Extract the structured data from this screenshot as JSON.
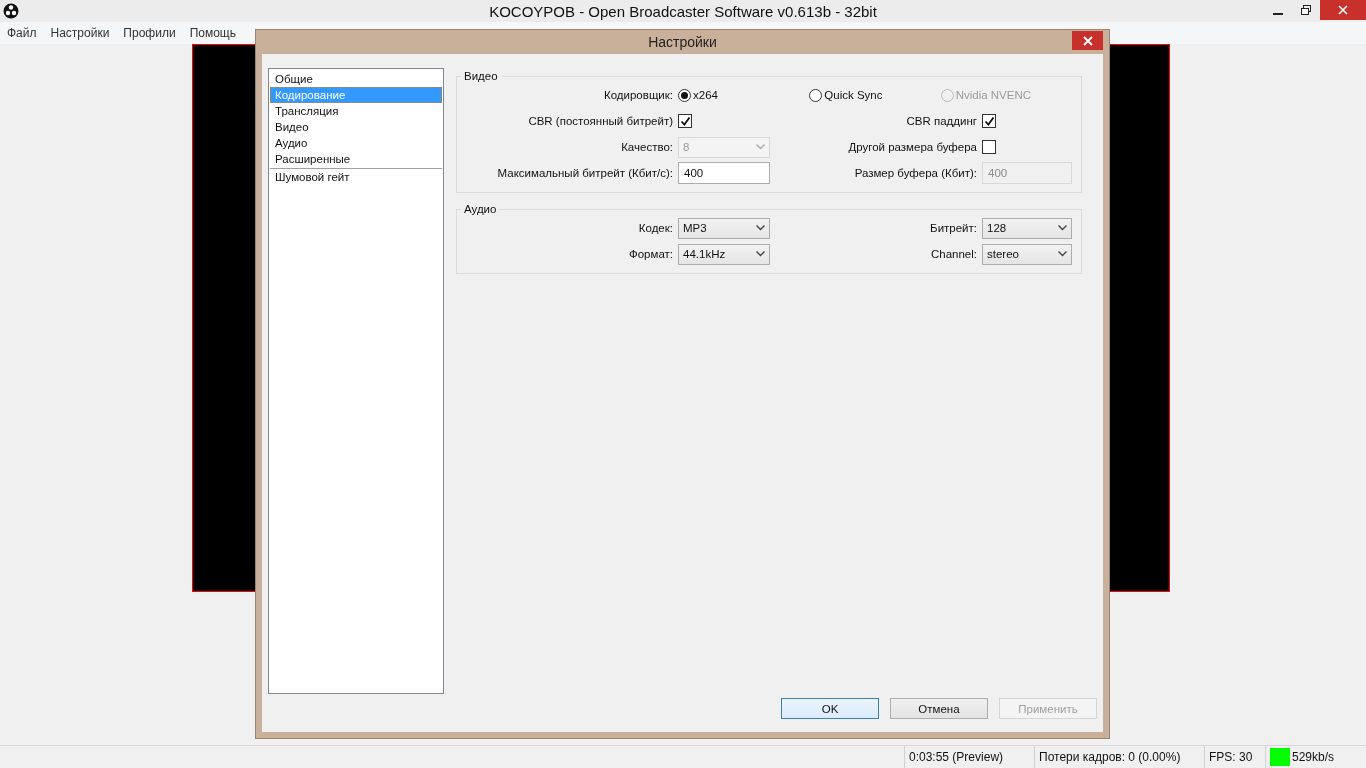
{
  "window": {
    "title": "KOCOYPOB - Open Broadcaster Software v0.613b - 32bit"
  },
  "menu": [
    "Файл",
    "Настройки",
    "Профили",
    "Помощь"
  ],
  "dialog": {
    "title": "Настройки",
    "sidebar": [
      [
        {
          "label": "Общие",
          "selected": false
        },
        {
          "label": "Кодирование",
          "selected": true
        },
        {
          "label": "Трансляция",
          "selected": false
        },
        {
          "label": "Видео",
          "selected": false
        },
        {
          "label": "Аудио",
          "selected": false
        },
        {
          "label": "Расширенные",
          "selected": false
        }
      ],
      [
        {
          "label": "Шумовой гейт",
          "selected": false
        }
      ]
    ],
    "video": {
      "title": "Видео",
      "encoder_label": "Кодировщик:",
      "encoders": [
        {
          "label": "x264",
          "selected": true,
          "disabled": false
        },
        {
          "label": "Quick Sync",
          "selected": false,
          "disabled": false
        },
        {
          "label": "Nvidia NVENC",
          "selected": false,
          "disabled": true
        }
      ],
      "cbr": {
        "label": "CBR (постоянный битрейт)",
        "checked": true
      },
      "cbr_padding": {
        "label": "CBR паддинг",
        "checked": true
      },
      "quality": {
        "label": "Качество:",
        "value": "8",
        "disabled": true
      },
      "custom_buffer": {
        "label": "Другой размера буфера",
        "checked": false
      },
      "max_bitrate": {
        "label": "Максимальный битрейт (Кбит/с):",
        "value": "400",
        "disabled": false
      },
      "buffer_size": {
        "label": "Размер буфера (Кбит):",
        "value": "400",
        "disabled": true
      }
    },
    "audio": {
      "title": "Аудио",
      "fields": [
        {
          "label": "Кодек:",
          "value": "MP3"
        },
        {
          "label": "Битрейт:",
          "value": "128"
        },
        {
          "label": "Формат:",
          "value": "44.1kHz"
        },
        {
          "label": "Channel:",
          "value": "stereo"
        }
      ]
    },
    "buttons": [
      {
        "label": "OK",
        "default": true,
        "disabled": false
      },
      {
        "label": "Отмена",
        "default": false,
        "disabled": false
      },
      {
        "label": "Применить",
        "default": false,
        "disabled": true
      }
    ]
  },
  "status_bar": {
    "time": "0:03:55 (Preview)",
    "dropped": "Потери кадров: 0 (0.00%)",
    "fps": "FPS: 30",
    "bitrate": "529kb/s"
  }
}
